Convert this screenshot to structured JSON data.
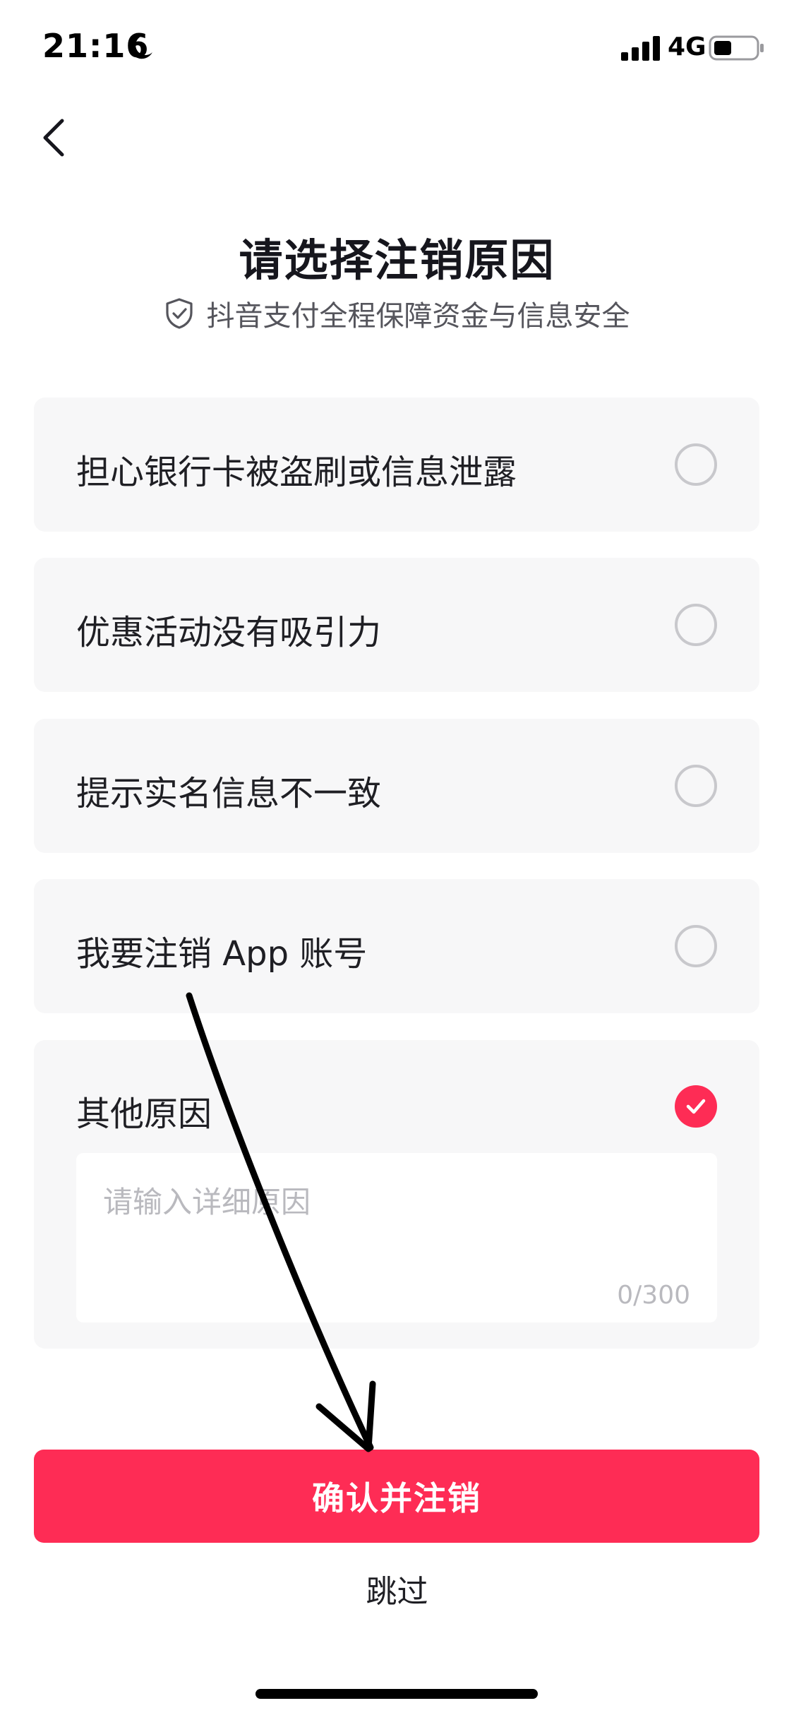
{
  "status_bar": {
    "time": "21:16",
    "network": "4G"
  },
  "header": {
    "title": "请选择注销原因",
    "security_note": "抖音支付全程保障资金与信息安全"
  },
  "reasons": [
    {
      "label": "担心银行卡被盗刷或信息泄露",
      "selected": false
    },
    {
      "label": "优惠活动没有吸引力",
      "selected": false
    },
    {
      "label": "提示实名信息不一致",
      "selected": false
    },
    {
      "label": "我要注销 App 账号",
      "selected": false
    },
    {
      "label": "其他原因",
      "selected": true
    }
  ],
  "detail_input": {
    "placeholder": "请输入详细原因",
    "value": "",
    "counter": "0/300"
  },
  "actions": {
    "confirm_label": "确认并注销",
    "skip_label": "跳过"
  },
  "colors": {
    "accent": "#fe2c55",
    "card_background": "#f7f7f8",
    "placeholder": "#b9b9be"
  },
  "icons": {
    "status": [
      "moon-icon",
      "signal-icon",
      "battery-icon"
    ],
    "back": "chevron-left-icon",
    "security": "shield-check-icon",
    "selected": "checkmark-icon"
  }
}
